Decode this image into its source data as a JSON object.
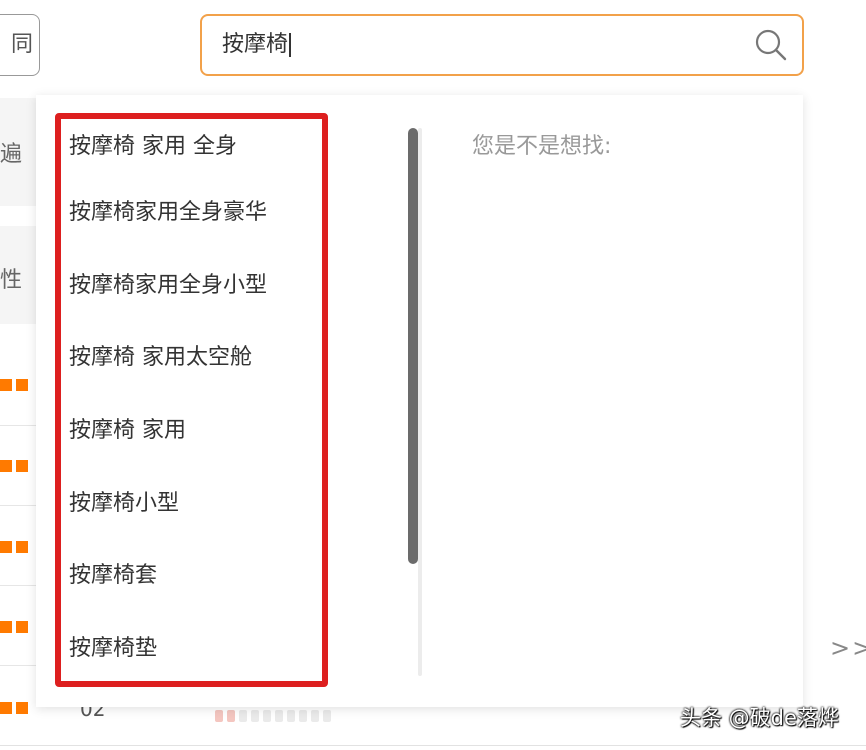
{
  "background": {
    "button_fragment": "同",
    "label_1": "遍",
    "label_2": "性",
    "row_number": "02",
    "pager_arrows": ">>"
  },
  "search": {
    "value": "按摩椅",
    "icon": "search-icon"
  },
  "suggestions": {
    "items": [
      "按摩椅 家用 全身",
      "按摩椅家用全身豪华",
      "按摩椅家用全身小型",
      "按摩椅 家用太空舱",
      "按摩椅 家用",
      "按摩椅小型",
      "按摩椅套",
      "按摩椅垫"
    ]
  },
  "hint": {
    "label": "您是不是想找:"
  },
  "annotation": {
    "color": "#dd1f1f"
  },
  "colors": {
    "accent": "#f2a14a",
    "orange_marker": "#ff7a00"
  },
  "watermark": "头条 @破de落烨"
}
